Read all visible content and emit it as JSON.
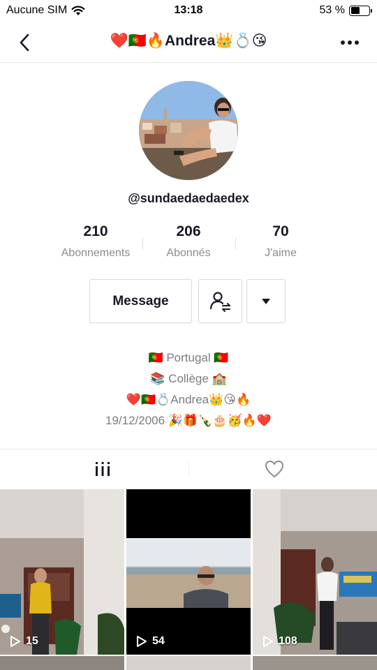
{
  "status_bar": {
    "carrier": "Aucune SIM",
    "time": "13:18",
    "battery_percent_label": "53 %",
    "battery_level": 0.53
  },
  "nav": {
    "title": "❤️🇵🇹🔥Andrea👑💍😘",
    "back_icon": "chevron-left-icon",
    "more_icon": "more-horizontal-icon"
  },
  "profile": {
    "username": "@sundaedaedaedex"
  },
  "stats": [
    {
      "value": "210",
      "label": "Abonnements"
    },
    {
      "value": "206",
      "label": "Abonnés"
    },
    {
      "value": "70",
      "label": "J'aime"
    }
  ],
  "actions": {
    "message_label": "Message",
    "follow_icon": "user-switch-icon",
    "dropdown_icon": "caret-down-icon"
  },
  "bio": {
    "lines": [
      "🇵🇹 Portugal 🇵🇹",
      "📚 Collège 🏫",
      "❤️🇵🇹💍Andrea👑😘🔥",
      "19/12/2006 🎉🎁🍾🎂🥳🔥❤️"
    ]
  },
  "tabs": {
    "videos_icon": "grid-bars-icon",
    "liked_icon": "heart-outline-icon"
  },
  "videos": [
    {
      "views": "15"
    },
    {
      "views": "54"
    },
    {
      "views": "108"
    }
  ],
  "colors": {
    "text_primary": "#161823",
    "text_secondary": "#8a8b91",
    "border": "#d8d8da"
  }
}
